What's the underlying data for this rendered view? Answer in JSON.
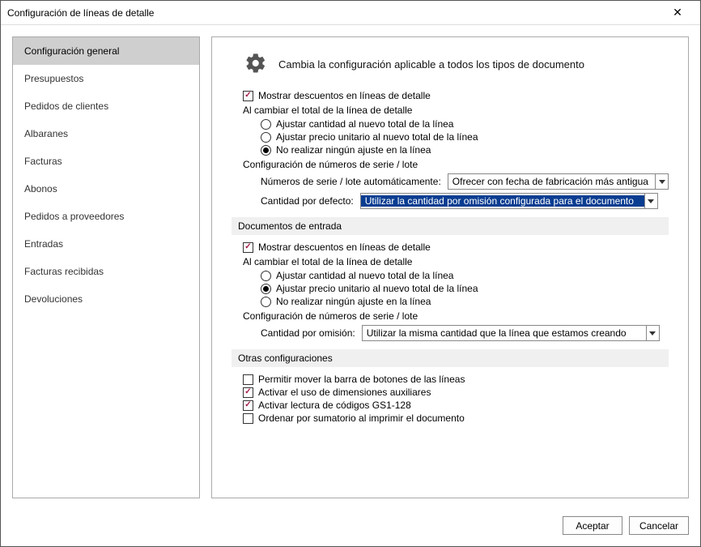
{
  "window": {
    "title": "Configuración de líneas de detalle"
  },
  "sidebar": {
    "items": [
      {
        "label": "Configuración general",
        "active": true
      },
      {
        "label": "Presupuestos",
        "active": false
      },
      {
        "label": "Pedidos de clientes",
        "active": false
      },
      {
        "label": "Albaranes",
        "active": false
      },
      {
        "label": "Facturas",
        "active": false
      },
      {
        "label": "Abonos",
        "active": false
      },
      {
        "label": "Pedidos a proveedores",
        "active": false
      },
      {
        "label": "Entradas",
        "active": false
      },
      {
        "label": "Facturas recibidas",
        "active": false
      },
      {
        "label": "Devoluciones",
        "active": false
      }
    ]
  },
  "header": {
    "title": "Cambia la configuración aplicable a todos los tipos de documento"
  },
  "salida": {
    "mostrar_descuentos": {
      "label": "Mostrar descuentos en líneas de detalle",
      "checked": true
    },
    "al_cambiar_label": "Al cambiar el total de la línea de detalle",
    "radios": [
      {
        "label": "Ajustar cantidad al nuevo total de la línea",
        "selected": false
      },
      {
        "label": "Ajustar precio unitario al nuevo total de la línea",
        "selected": false
      },
      {
        "label": "No realizar ningún ajuste en la línea",
        "selected": true
      }
    ],
    "serie_label": "Configuración de números de serie / lote",
    "serie_auto_label": "Números de serie / lote automáticamente:",
    "serie_auto_value": "Ofrecer con fecha de fabricación más antigua",
    "cantidad_defecto_label": "Cantidad por defecto:",
    "cantidad_defecto_value": "Utilizar la cantidad por omisión configurada para el documento"
  },
  "entrada": {
    "section_title": "Documentos de entrada",
    "mostrar_descuentos": {
      "label": "Mostrar descuentos en líneas de detalle",
      "checked": true
    },
    "al_cambiar_label": "Al cambiar el total de la línea de detalle",
    "radios": [
      {
        "label": "Ajustar cantidad al nuevo total de la línea",
        "selected": false
      },
      {
        "label": "Ajustar precio unitario al nuevo total de la línea",
        "selected": true
      },
      {
        "label": "No realizar ningún ajuste en la línea",
        "selected": false
      }
    ],
    "serie_label": "Configuración de números de serie / lote",
    "cantidad_omision_label": "Cantidad por omisión:",
    "cantidad_omision_value": "Utilizar la misma cantidad que la línea que estamos creando"
  },
  "otras": {
    "section_title": "Otras configuraciones",
    "items": [
      {
        "label": "Permitir mover la barra de botones de las líneas",
        "checked": false
      },
      {
        "label": "Activar el uso de dimensiones auxiliares",
        "checked": true
      },
      {
        "label": "Activar lectura de códigos GS1-128",
        "checked": true
      },
      {
        "label": "Ordenar por sumatorio al imprimir el documento",
        "checked": false
      }
    ]
  },
  "footer": {
    "accept": "Aceptar",
    "cancel": "Cancelar"
  }
}
